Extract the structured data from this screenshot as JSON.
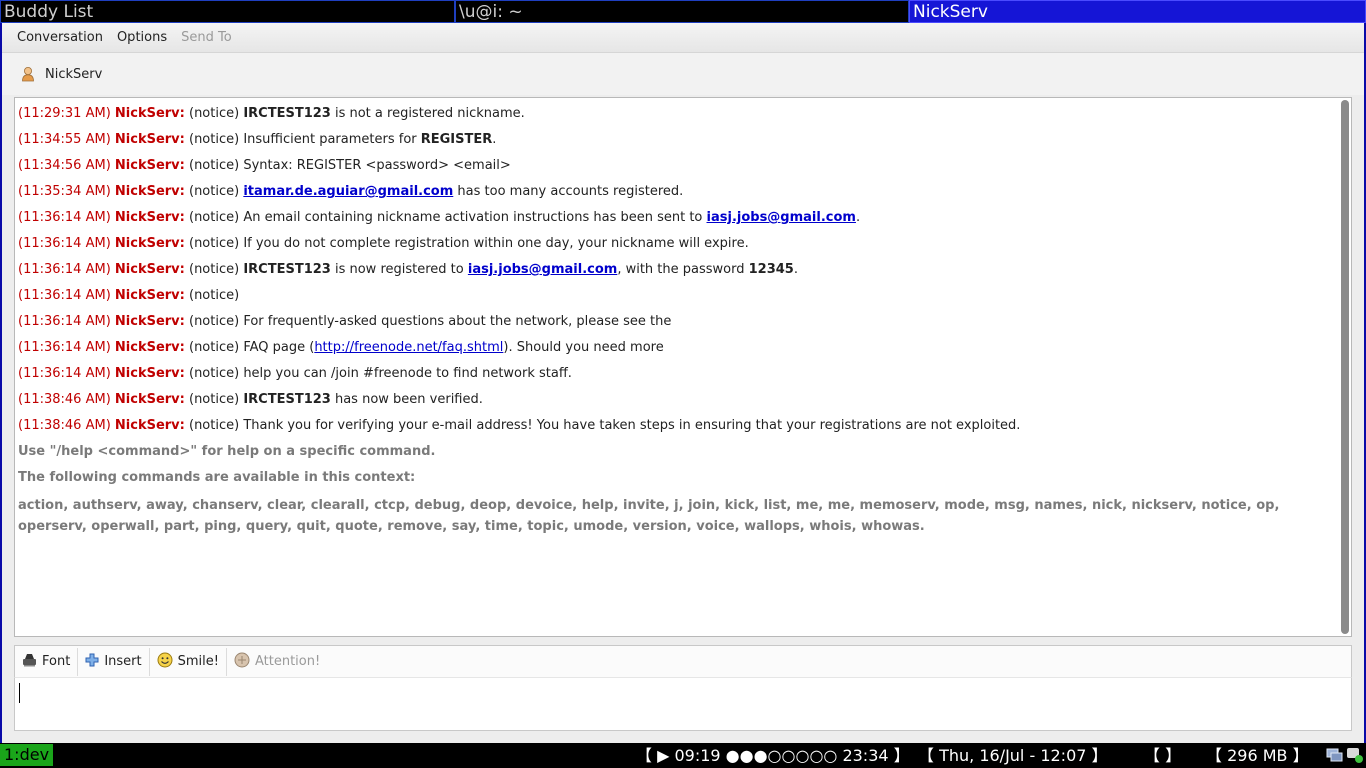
{
  "windows": {
    "buddy_list": "Buddy List",
    "terminal": "\\u@i: ~",
    "active": "NickServ"
  },
  "menu": {
    "conversation": "Conversation",
    "options": "Options",
    "send_to": "Send To"
  },
  "conversation": {
    "nick": "NickServ"
  },
  "log": [
    {
      "ts": "(11:29:31 AM)",
      "who": "NickServ:",
      "tag": "(notice)",
      "parts": [
        {
          "t": " "
        },
        {
          "t": "IRCTEST123",
          "s": "b"
        },
        {
          "t": " is not a registered nickname."
        }
      ]
    },
    {
      "ts": "(11:34:55 AM)",
      "who": "NickServ:",
      "tag": "(notice)",
      "parts": [
        {
          "t": " Insufficient parameters for "
        },
        {
          "t": "REGISTER",
          "s": "b"
        },
        {
          "t": "."
        }
      ]
    },
    {
      "ts": "(11:34:56 AM)",
      "who": "NickServ:",
      "tag": "(notice)",
      "parts": [
        {
          "t": " Syntax: REGISTER <password> <email>"
        }
      ]
    },
    {
      "ts": "(11:35:34 AM)",
      "who": "NickServ:",
      "tag": "(notice)",
      "parts": [
        {
          "t": " "
        },
        {
          "t": "itamar.de.aguiar@gmail.com",
          "s": "lnk"
        },
        {
          "t": " has too many accounts registered."
        }
      ]
    },
    {
      "ts": "(11:36:14 AM)",
      "who": "NickServ:",
      "tag": "(notice)",
      "parts": [
        {
          "t": " An email containing nickname activation instructions has been sent to "
        },
        {
          "t": "iasj.jobs@gmail.com",
          "s": "lnk"
        },
        {
          "t": "."
        }
      ]
    },
    {
      "ts": "(11:36:14 AM)",
      "who": "NickServ:",
      "tag": "(notice)",
      "parts": [
        {
          "t": " If you do not complete registration within one day, your nickname will expire."
        }
      ]
    },
    {
      "ts": "(11:36:14 AM)",
      "who": "NickServ:",
      "tag": "(notice)",
      "parts": [
        {
          "t": " "
        },
        {
          "t": "IRCTEST123",
          "s": "b"
        },
        {
          "t": " is now registered to "
        },
        {
          "t": "iasj.jobs@gmail.com",
          "s": "lnk"
        },
        {
          "t": ", with the password "
        },
        {
          "t": "12345",
          "s": "b"
        },
        {
          "t": "."
        }
      ]
    },
    {
      "ts": "(11:36:14 AM)",
      "who": "NickServ:",
      "tag": "(notice)",
      "parts": []
    },
    {
      "ts": "(11:36:14 AM)",
      "who": "NickServ:",
      "tag": "(notice)",
      "parts": [
        {
          "t": " For frequently-asked questions about the network, please see the"
        }
      ]
    },
    {
      "ts": "(11:36:14 AM)",
      "who": "NickServ:",
      "tag": "(notice)",
      "parts": [
        {
          "t": " FAQ page ("
        },
        {
          "t": "http://freenode.net/faq.shtml",
          "s": "lnk2"
        },
        {
          "t": "). Should you need more"
        }
      ]
    },
    {
      "ts": "(11:36:14 AM)",
      "who": "NickServ:",
      "tag": "(notice)",
      "parts": [
        {
          "t": " help you can /join #freenode to find network staff."
        }
      ]
    },
    {
      "ts": "(11:38:46 AM)",
      "who": "NickServ:",
      "tag": "(notice)",
      "parts": [
        {
          "t": " "
        },
        {
          "t": "IRCTEST123",
          "s": "b"
        },
        {
          "t": " has now been verified."
        }
      ]
    },
    {
      "ts": "(11:38:46 AM)",
      "who": "NickServ:",
      "tag": "(notice)",
      "parts": [
        {
          "t": " Thank you for verifying your e-mail address! You have taken steps in ensuring that your registrations are not exploited."
        }
      ]
    }
  ],
  "system": {
    "help_hint": "Use \"/help <command>\" for help on a specific command.",
    "available": "The following commands are available in this context:",
    "commands": "action, authserv, away, chanserv, clear, clearall, ctcp, debug, deop, devoice, help, invite, j, join, kick, list, me, me, memoserv, mode, msg, names, nick, nickserv, notice, op, operserv, operwall, part, ping, query, quit, quote, remove, say, time, topic, umode, version, voice, wallops, whois, whowas."
  },
  "toolbar": {
    "font": "Font",
    "insert": "Insert",
    "smile": "Smile!",
    "attention": "Attention!"
  },
  "statusbar": {
    "workspace": "1:dev",
    "media": "【 ▶ 09:19 ●●●○○○○○ 23:34 】",
    "datetime": "【 Thu, 16/Jul - 12:07 】",
    "empty": "【   】",
    "memory": "【 296 MB 】"
  },
  "colors": {
    "timestamp": "#c00000",
    "link": "#0000cc",
    "active_title": "#1515d6",
    "workspace": "#1aa51a"
  }
}
